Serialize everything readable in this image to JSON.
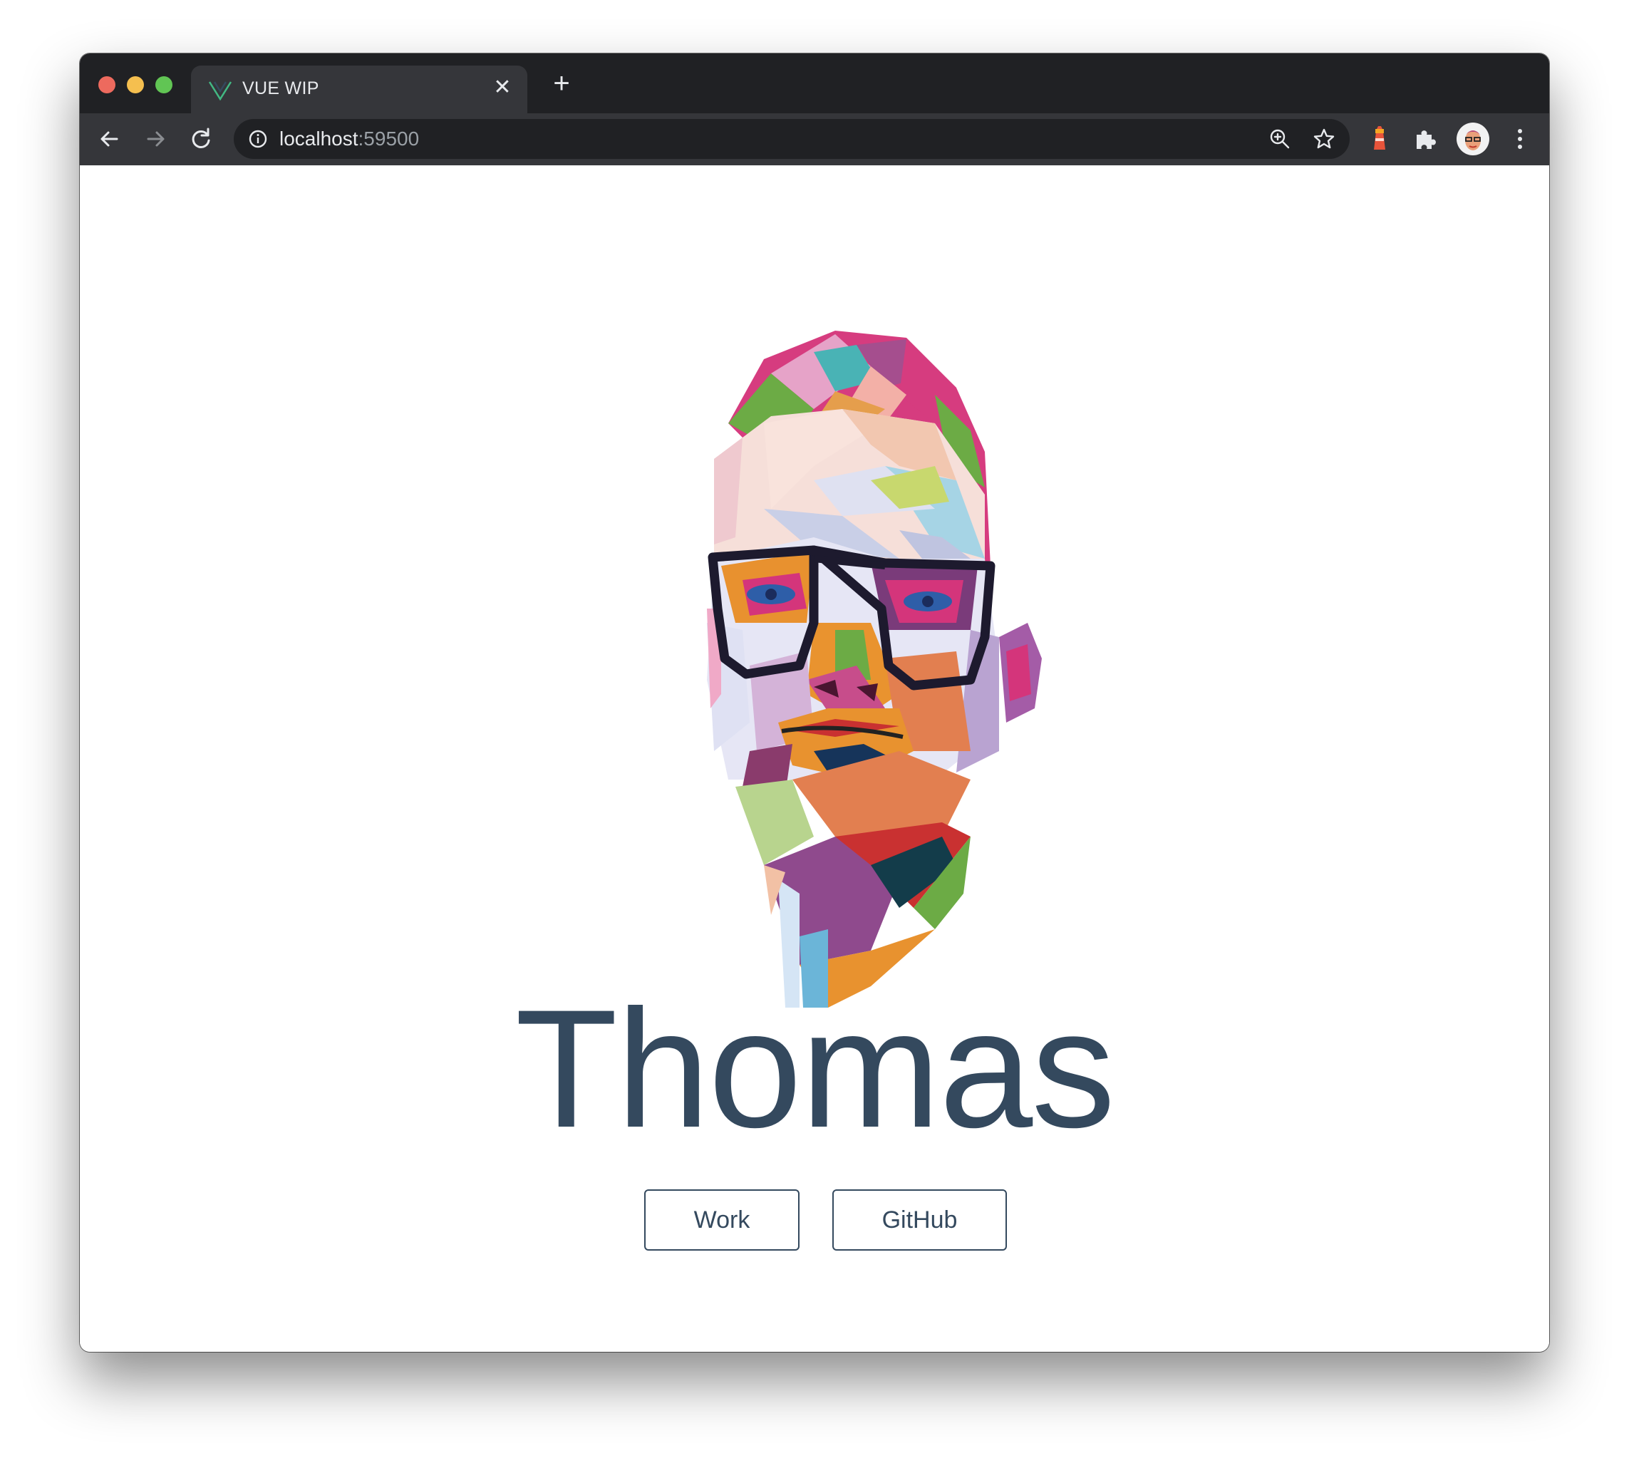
{
  "browser": {
    "tab": {
      "title": "VUE WIP",
      "icon": "vue-icon",
      "close_glyph": "✕"
    },
    "new_tab_glyph": "+",
    "address": {
      "host": "localhost",
      "port": ":59500"
    }
  },
  "page": {
    "name": "Thomas",
    "buttons": [
      {
        "label": "Work"
      },
      {
        "label": "GitHub"
      }
    ],
    "text_color": "#34495e"
  },
  "colors": {
    "tabstrip": "#202124",
    "toolbar": "#35363a",
    "accent_vue": "#42b883"
  }
}
